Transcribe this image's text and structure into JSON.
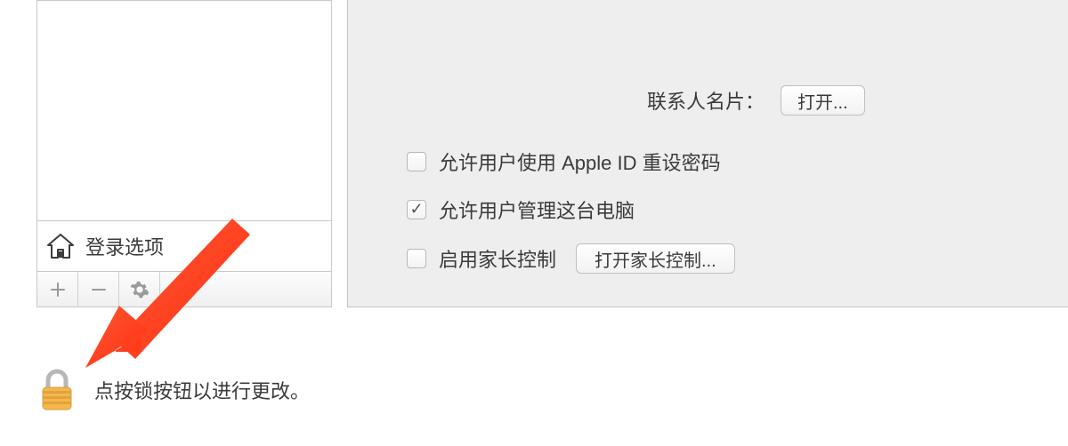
{
  "sidebar": {
    "login_options_label": "登录选项"
  },
  "content": {
    "contact_card_label": "联系人名片：",
    "open_button_label": "打开...",
    "checkbox_allow_reset_pw": "允许用户使用 Apple ID 重设密码",
    "checkbox_allow_reset_pw_checked": false,
    "checkbox_allow_manage": "允许用户管理这台电脑",
    "checkbox_allow_manage_checked": true,
    "checkbox_parental": "启用家长控制",
    "checkbox_parental_checked": false,
    "open_parental_button_label": "打开家长控制..."
  },
  "footer": {
    "lock_text": "点按锁按钮以进行更改。"
  }
}
